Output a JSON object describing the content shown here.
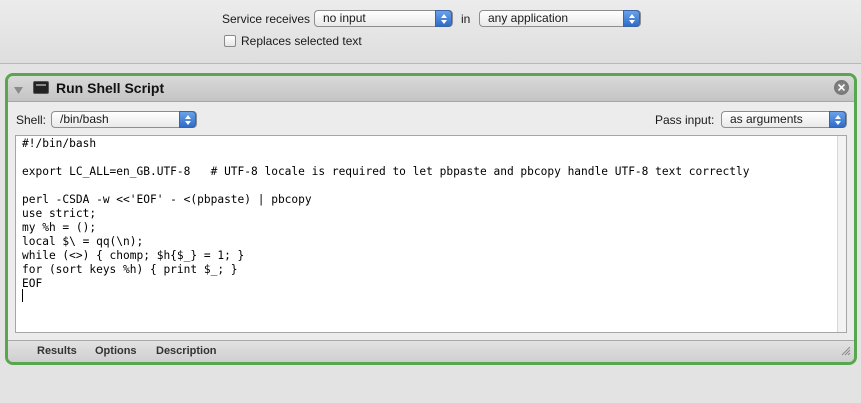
{
  "service_bar": {
    "receives_label": "Service receives",
    "input_type": "no input",
    "in_label": "in",
    "application": "any application",
    "replaces_label": "Replaces selected text",
    "replaces_checked": false
  },
  "action": {
    "title": "Run Shell Script",
    "shell_label": "Shell:",
    "shell_value": "/bin/bash",
    "pass_input_label": "Pass input:",
    "pass_input_value": "as arguments",
    "script": "#!/bin/bash\n\nexport LC_ALL=en_GB.UTF-8   # UTF-8 locale is required to let pbpaste and pbcopy handle UTF-8 text correctly\n\nperl -CSDA -w <<'EOF' - <(pbpaste) | pbcopy\nuse strict;\nmy %h = ();\nlocal $\\ = qq(\\n);\nwhile (<>) { chomp; $h{$_} = 1; }\nfor (sort keys %h) { print $_; }\nEOF",
    "footer_tabs": [
      "Results",
      "Options",
      "Description"
    ]
  },
  "colors": {
    "panel_border": "#58a64d",
    "popup_arrow": "#2f6cc9"
  },
  "icons": [
    "popup-arrows-icon",
    "terminal-icon",
    "disclosure-triangle-icon",
    "close-icon",
    "resize-grip-icon"
  ]
}
